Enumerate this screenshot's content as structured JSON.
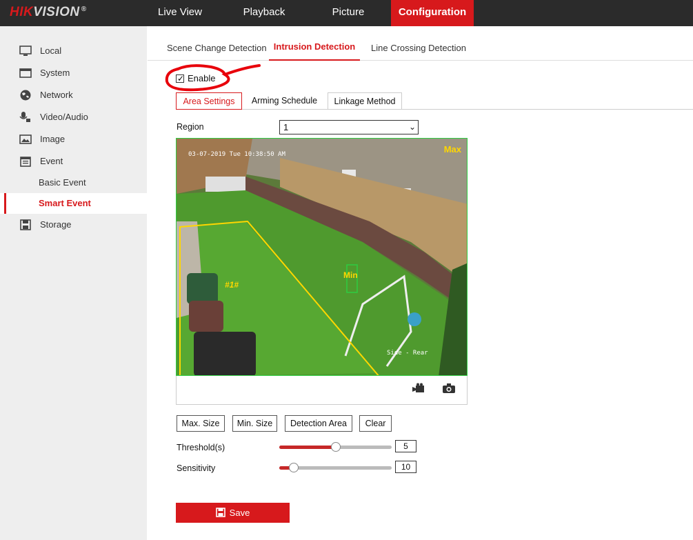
{
  "brand": {
    "logo_hik": "HIK",
    "logo_vision": "VISION",
    "logo_reg": "®"
  },
  "topnav": {
    "live_view": "Live View",
    "playback": "Playback",
    "picture": "Picture",
    "configuration": "Configuration"
  },
  "sidebar": {
    "local": "Local",
    "system": "System",
    "network": "Network",
    "video_audio": "Video/Audio",
    "image": "Image",
    "event": "Event",
    "basic_event": "Basic Event",
    "smart_event": "Smart Event",
    "storage": "Storage"
  },
  "tabs": {
    "scene_change": "Scene Change Detection",
    "intrusion": "Intrusion Detection",
    "line_crossing": "Line Crossing Detection"
  },
  "enable": {
    "label": "Enable",
    "checked": true
  },
  "subtabs": {
    "area_settings": "Area Settings",
    "arming_schedule": "Arming Schedule",
    "linkage_method": "Linkage Method"
  },
  "region": {
    "label": "Region",
    "value": "1"
  },
  "video": {
    "timestamp": "03-07-2019 Tue 10:38:50 AM",
    "max_label": "Max",
    "min_label": "Min",
    "region_label": "#1#",
    "camera_name": "Side - Rear"
  },
  "buttons": {
    "max_size": "Max. Size",
    "min_size": "Min. Size",
    "detection_area": "Detection Area",
    "clear": "Clear"
  },
  "threshold": {
    "label": "Threshold(s)",
    "value": "5",
    "level": 0.5
  },
  "sensitivity": {
    "label": "Sensitivity",
    "value": "10",
    "level": 0.13
  },
  "save": {
    "label": "Save"
  },
  "colors": {
    "accent": "#d7191c",
    "topbar": "#2b2b2b",
    "sidebar": "#eeeeee",
    "region_line": "#ffd700"
  }
}
